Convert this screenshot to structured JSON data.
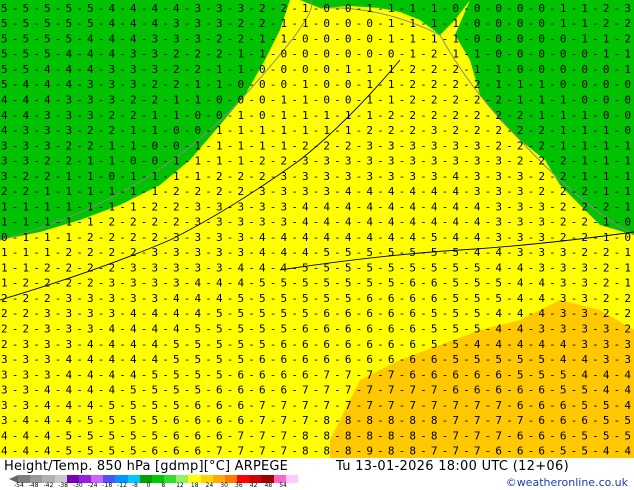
{
  "map": {
    "colors": {
      "green": "#00c200",
      "yellow": "#ffff00",
      "orange": "#ffc800",
      "gray": "#888888",
      "digits": "#000000"
    },
    "rows": [
      "5-5-5-5-5-4-4-4-4-3-3-3-2-2-1-0-0-1-1-1-1-0-0-0-0-0-1-1-2-3",
      "5-5-5-5-5-4-4-4-3-3-3-2-2-1-1-0-0-0-1-1-1-1-0-0-0-0-1-1-2-2",
      "5-5-5-5-4-4-4-3-3-3-2-2-1-1-0-0-0-0-1-1-1-1-0-0-0-0-0-1-1-2",
      "5-5-5-4-4-4-3-3-2-2-2-1-1-0-0-0-0-0-0-1-2-1-1-0-0-0-0-0-1-1",
      "5-5-4-4-4-3-3-3-2-2-1-1-0-0-0-0-1-1-1-2-2-2-1-1-0-0-0-0-0-1",
      "5-4-4-4-3-3-3-2-2-1-1-0-0-0-1-0-0-1-1-2-2-2-2-1-1-1-0-0-0-0",
      "4-4-4-3-3-3-2-2-1-1-0-0-0-1-1-0-0-1-1-2-2-2-2-2-1-1-1-0-0-0",
      "4-4-3-3-3-2-2-1-1-0-0-1-0-1-1-1-1-1-2-2-2-2-2-2-2-1-1-1-0-0",
      "4-3-3-3-2-2-1-1-0-0-1-1-1-1-1-1-1-2-2-2-3-2-2-2-2-2-1-1-1-0",
      "3-3-3-2-2-1-1-0-0-1-1-1-1-1-2-2-2-3-3-3-3-3-3-2-2-2-1-1-1-1",
      "3-3-2-2-1-1-0-0-1-1-1-1-2-2-3-3-3-3-3-3-3-3-3-3-2-2-2-1-1-1",
      "3-2-2-1-1-0-1-1-1-1-2-2-2-3-3-3-3-3-3-3-3-4-3-3-3-2-2-1-1-1",
      "2-2-1-1-1-1-1-1-2-2-2-2-3-3-3-3-4-4-4-4-4-4-3-3-3-2-2-2-1-1",
      "1-1-1-1-1-1-1-2-2-3-3-3-3-3-4-4-4-4-4-4-4-4-4-3-3-3-2-2-2-1",
      "1-1-1-1-1-2-2-2-2-3-3-3-3-3-4-4-4-4-4-4-4-4-4-3-3-3-2-2-1-0",
      "0-1-1-1-2-2-2-2-3-3-3-3-4-4-4-4-4-4-4-4-5-4-4-3-3-3-2-2-1-0",
      "1-1-1-2-2-2-2-3-3-3-3-3-4-4-4-5-5-5-5-5-5-5-4-4-3-3-3-2-2-1",
      "1-1-2-2-2-2-3-3-3-3-3-4-4-4-5-5-5-5-5-5-5-5-5-4-4-3-3-3-2-1",
      "1-2-2-2-2-3-3-3-3-4-4-4-5-5-5-5-5-5-5-6-6-5-5-5-4-4-3-3-2-1",
      "2-2-2-3-3-3-3-3-4-4-4-5-5-5-5-5-5-6-6-6-6-5-5-5-4-4-3-3-2-2",
      "2-2-3-3-3-3-4-4-4-4-5-5-5-5-5-6-6-6-6-6-5-5-5-4-4-4-3-3-2-2",
      "2-2-3-3-3-4-4-4-4-5-5-5-5-5-6-6-6-6-6-6-5-5-5-4-4-3-3-3-3-2",
      "2-3-3-3-4-4-4-4-5-5-5-5-5-6-6-6-6-6-6-6-5-5-4-4-4-4-4-3-3-3",
      "3-3-3-4-4-4-4-4-5-5-5-5-6-6-6-6-6-6-6-6-6-5-5-5-5-5-4-4-3-3",
      "3-3-3-4-4-4-4-5-5-5-5-6-6-6-6-7-7-7-7-6-6-6-6-6-5-5-5-4-4-4",
      "3-3-4-4-4-4-5-5-5-5-6-6-6-6-7-7-7-7-7-7-7-6-6-6-6-6-5-5-4-4",
      "3-3-4-4-4-5-5-5-5-6-6-6-7-7-7-7-7-7-7-7-7-7-7-7-6-6-6-5-5-4",
      "3-4-4-4-5-5-5-5-6-6-6-6-7-7-7-8-8-8-8-8-8-7-7-7-7-6-6-6-5-5",
      "4-4-4-5-5-5-5-5-6-6-6-7-7-7-8-8-8-8-8-8-8-7-7-7-6-6-6-5-5-5",
      "4-4-4-5-5-5-5-6-6-6-7-7-7-7-8-8-8-9-8-8-7-7-7-6-6-6-5-5-4-4"
    ]
  },
  "footer": {
    "title": "Height/Temp. 850 hPa [gdmp][°C] ARPEGE",
    "datetime": "Tu 13-01-2026 18:00 UTC (12+06)",
    "credit": "©weatheronline.co.uk",
    "colorbar": {
      "colors": [
        "#7f7f7f",
        "#9a9a9a",
        "#b0b0b0",
        "#c8c8c8",
        "#7a00b4",
        "#9c1ce0",
        "#c864ff",
        "#5050ff",
        "#0096ff",
        "#00c8ff",
        "#00a000",
        "#00c800",
        "#32dc32",
        "#96f064",
        "#ffff00",
        "#ffd200",
        "#ffaa00",
        "#ff7800",
        "#ff0000",
        "#d20000",
        "#a00000",
        "#ff64c8",
        "#ffc8ff"
      ],
      "ticks": [
        "-54",
        "-48",
        "-42",
        "-38",
        "-30",
        "-24",
        "-18",
        "-12",
        "-8",
        "0",
        "8",
        "12",
        "18",
        "24",
        "30",
        "36",
        "42",
        "48",
        "54"
      ]
    }
  }
}
